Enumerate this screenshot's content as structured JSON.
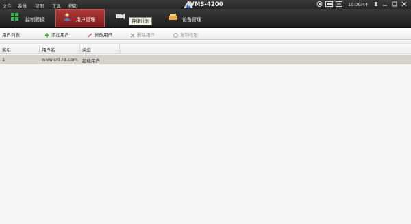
{
  "menubar": {
    "menus": [
      "文件",
      "系统",
      "视图",
      "工具",
      "帮助"
    ],
    "title": "iVMS-4200",
    "clock": "10:09:44"
  },
  "tabs": [
    {
      "label": "控制面板",
      "icon": "control-panel-icon"
    },
    {
      "label": "用户管理",
      "icon": "user-management-icon",
      "active": true
    },
    {
      "label": "",
      "icon": "storage-schedule-icon"
    },
    {
      "label": "设备管理",
      "icon": "device-management-icon"
    }
  ],
  "tooltip": "存储计划",
  "toolbar": {
    "section_label": "用户列表",
    "add_user": "添加用户",
    "edit_user": "修改用户",
    "delete_user": "删除用户",
    "copy_permission": "复制权限"
  },
  "table": {
    "headers": [
      "索引",
      "用户名",
      "类型"
    ],
    "rows": [
      {
        "index": "1",
        "username": "www.cr173.com",
        "type": "超级用户"
      }
    ]
  },
  "colors": {
    "active_tab": "#9a2a2a",
    "topbar": "#2b2b2b",
    "selected_row": "#d6d2cb",
    "add_icon": "#3aa53a"
  }
}
